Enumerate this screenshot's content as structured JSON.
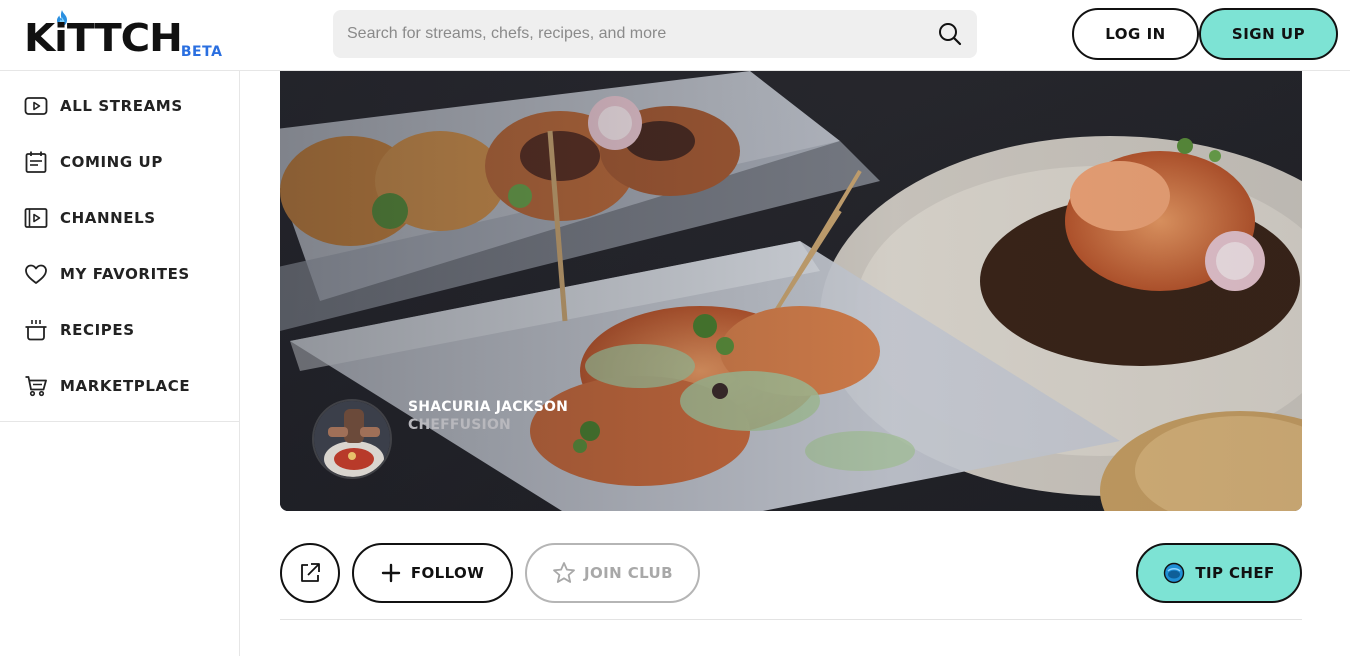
{
  "header": {
    "logo_text": "KiTTCH",
    "logo_badge": "BETA",
    "search": {
      "placeholder": "Search for streams, chefs, recipes, and more"
    },
    "login_label": "LOG IN",
    "signup_label": "SIGN UP"
  },
  "sidebar": {
    "items": [
      {
        "label": "ALL STREAMS",
        "icon": "play-icon"
      },
      {
        "label": "COMING UP",
        "icon": "calendar-icon"
      },
      {
        "label": "CHANNELS",
        "icon": "channels-icon"
      },
      {
        "label": "MY FAVORITES",
        "icon": "heart-icon"
      },
      {
        "label": "RECIPES",
        "icon": "pot-icon"
      },
      {
        "label": "MARKETPLACE",
        "icon": "cart-icon"
      }
    ]
  },
  "hero": {
    "chef_name": "SHACURIA JACKSON",
    "channel_name": "CHEFFUSION"
  },
  "actions": {
    "follow_label": "FOLLOW",
    "join_label": "JOIN CLUB",
    "tip_label": "TIP CHEF"
  },
  "colors": {
    "accent": "#7de3d4",
    "beta": "#2a6fe0",
    "text": "#111111"
  }
}
